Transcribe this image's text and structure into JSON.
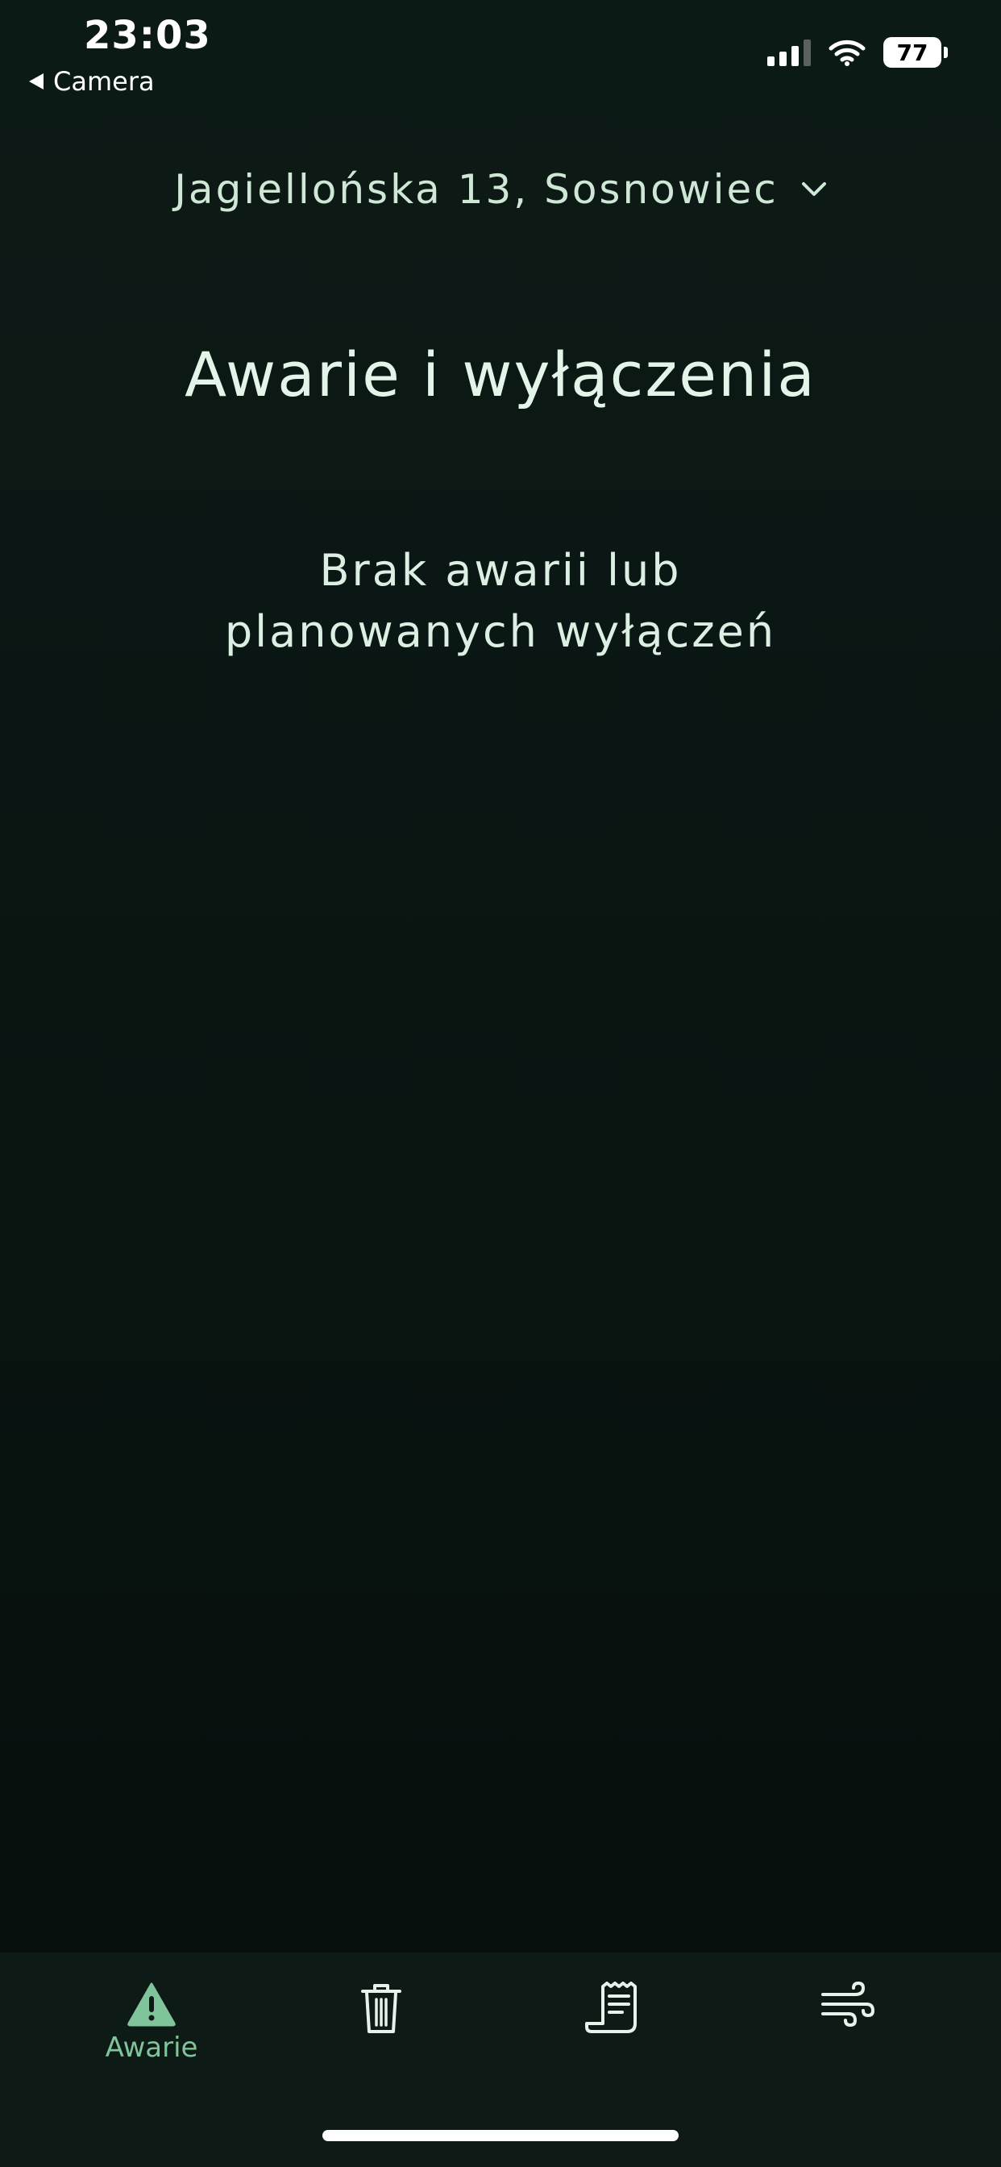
{
  "status_bar": {
    "time": "23:03",
    "back_label": "Camera",
    "battery": "77",
    "icons": [
      "signal-icon",
      "wifi-icon",
      "battery-icon"
    ]
  },
  "header": {
    "address": "Jagiellońska 13, Sosnowiec",
    "title": "Awarie i wyłączenia"
  },
  "main": {
    "empty_line1": "Brak awarii lub",
    "empty_line2": "planowanych wyłączeń"
  },
  "tabbar": {
    "tabs": [
      {
        "label": "Awarie",
        "icon": "warning-icon",
        "active": true
      },
      {
        "label": "",
        "icon": "trash-icon",
        "active": false
      },
      {
        "label": "",
        "icon": "receipt-icon",
        "active": false
      },
      {
        "label": "",
        "icon": "wind-icon",
        "active": false
      }
    ]
  },
  "colors": {
    "background": "#0a1512",
    "accent": "#7fc49a",
    "text": "#dcefe3"
  }
}
